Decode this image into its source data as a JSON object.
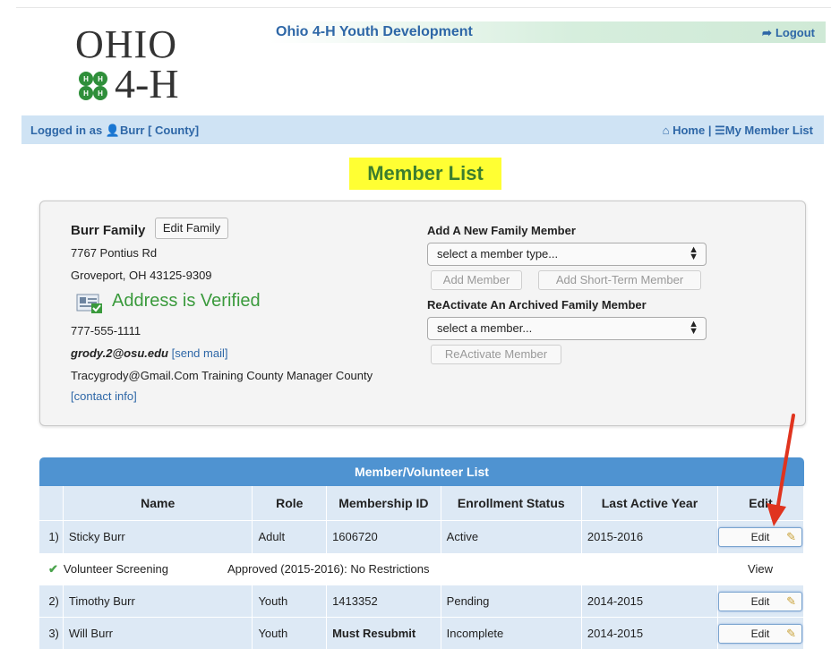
{
  "logo": {
    "ohio": "OHIO",
    "fourh": "4-H"
  },
  "header": {
    "site_title": "Ohio 4-H Youth Development",
    "logout": "Logout"
  },
  "nav": {
    "logged_prefix": "Logged in as",
    "user": "Burr",
    "county": "[ County]",
    "home": "Home",
    "sep": "|",
    "my_member_list": "My Member List"
  },
  "page_title": "Member List",
  "family": {
    "name": "Burr Family",
    "edit_family": "Edit Family",
    "street": "7767 Pontius Rd",
    "city": "Groveport, OH 43125-9309",
    "verified": "Address is Verified",
    "phone": "777-555-1111",
    "email": "grody.2@osu.edu",
    "send_mail": "[send mail]",
    "note": "Tracygrody@Gmail.Com Training County Manager County",
    "contact_info": "[contact info]"
  },
  "add_member": {
    "heading": "Add A New Family Member",
    "select_value": "select a member type...",
    "add_button": "Add Member",
    "short_term_button": "Add Short-Term Member"
  },
  "reactivate": {
    "heading": "ReActivate An Archived Family Member",
    "select_value": "select a member...",
    "button": "ReActivate Member"
  },
  "table": {
    "title": "Member/Volunteer List",
    "columns": [
      "",
      "Name",
      "Role",
      "Membership ID",
      "Enrollment Status",
      "Last Active Year",
      "Edit"
    ],
    "rows": [
      {
        "num": "1)",
        "name": "Sticky Burr",
        "role": "Adult",
        "id": "1606720",
        "status": "Active",
        "year": "2015-2016",
        "edit": "Edit"
      },
      {
        "num": "2)",
        "name": "Timothy Burr",
        "role": "Youth",
        "id": "1413352",
        "status": "Pending",
        "year": "2014-2015",
        "edit": "Edit"
      },
      {
        "num": "3)",
        "name": "Will Burr",
        "role": "Youth",
        "id": "Must Resubmit",
        "status": "Incomplete",
        "year": "2014-2015",
        "edit": "Edit"
      }
    ],
    "screening": {
      "label": "Volunteer Screening",
      "status": "Approved (2015-2016): No Restrictions",
      "view": "View"
    }
  },
  "colors": {
    "brand_blue": "#2e67a7",
    "verified_green": "#3a9a3c",
    "title_highlight": "#ffff33",
    "arrow_red": "#e0341f"
  }
}
